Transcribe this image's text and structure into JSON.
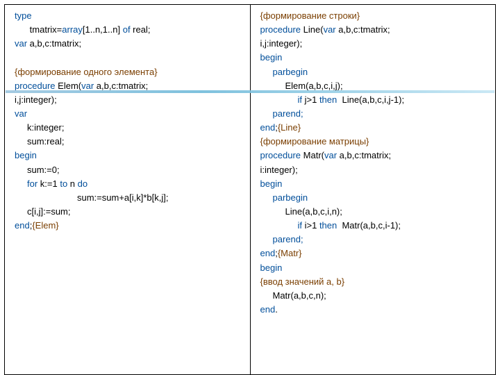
{
  "left": {
    "l1a": "type",
    "l2a": "      tmatrix=",
    "l2b": "array",
    "l2c": "[1..n,1..n] ",
    "l2d": "of",
    "l2e": " real;",
    "l3a": "var",
    "l3b": " a,b,c:tmatrix;",
    "l4a": "{формирование одного элемента}",
    "l5a": "procedure",
    "l5b": " Elem(",
    "l5c": "var",
    "l5d": " a,b,c:tmatrix;",
    "l6": "i,j:integer);",
    "l7": "var",
    "l8": "k:integer;",
    "l9": "sum:real;",
    "l10": "begin",
    "l11": "sum:=0;",
    "l12a": "for",
    "l12b": " k:=1 ",
    "l12c": "to",
    "l12d": " n ",
    "l12e": "do",
    "l13": "sum:=sum+a[i,k]*b[k,j];",
    "l14": "c[i,j]:=sum;",
    "l15a": "end",
    "l15b": ";",
    "l15c": "{Elem}"
  },
  "right": {
    "r1": "{формирование строки}",
    "r2a": "procedure",
    "r2b": " Line(",
    "r2c": "var",
    "r2d": " a,b,c:tmatrix;",
    "r3": "i,j:integer);",
    "r4": "begin",
    "r5": "parbegin",
    "r6": "Elem(a,b,c,i,j);",
    "r7a": "if",
    "r7b": " j>1 ",
    "r7c": "then",
    "r7d": "  Line(a,b,c,i,j-1);",
    "r8": "parend;",
    "r9a": "end",
    "r9b": ";",
    "r9c": "{Line}",
    "r10": "{формирование матрицы}",
    "r11a": "procedure",
    "r11b": " Matr(",
    "r11c": "var",
    "r11d": " a,b,c:tmatrix;",
    "r12": "i:integer);",
    "r13": "begin",
    "r14": "parbegin",
    "r15": "Line(a,b,c,i,n);",
    "r16a": "if",
    "r16b": " i>1 ",
    "r16c": "then",
    "r16d": "  Matr(a,b,c,i-1);",
    "r17": "parend;",
    "r18a": "end",
    "r18b": ";",
    "r18c": "{Matr}",
    "r19": "begin",
    "r20": "{ввод значений a, b}",
    "r21": "Matr(a,b,c,n);",
    "r22a": "end",
    "r22b": "."
  }
}
